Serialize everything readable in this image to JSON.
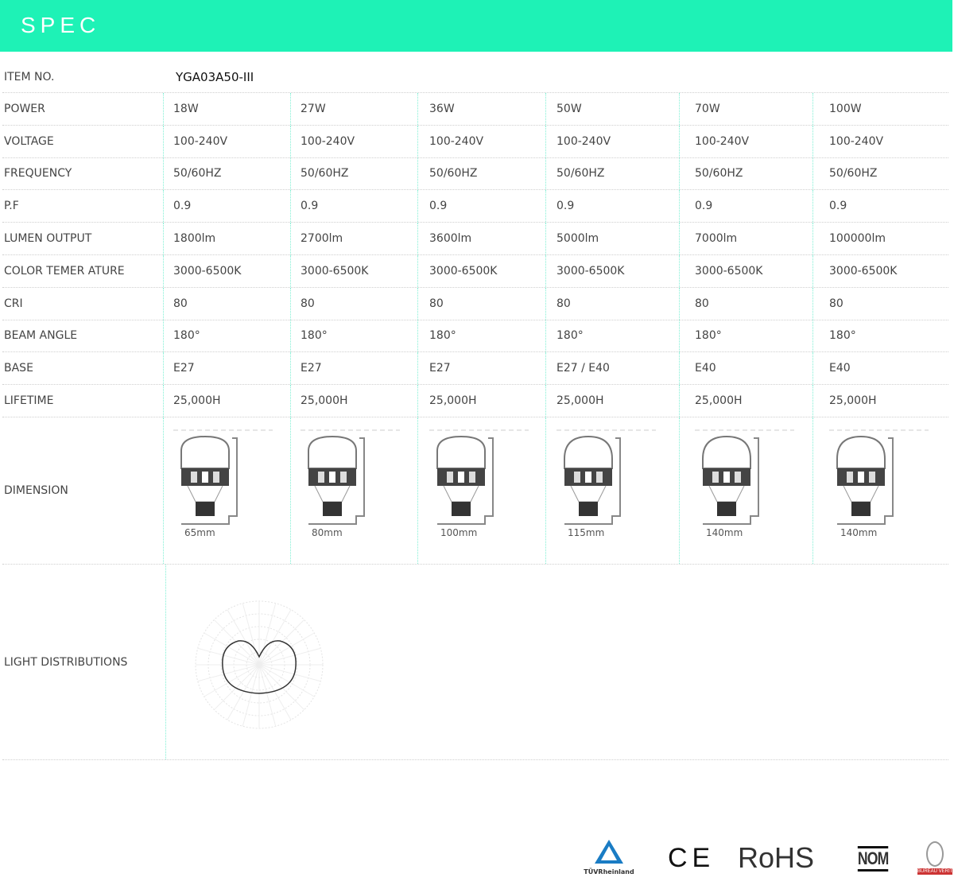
{
  "header": {
    "title": "SPEC"
  },
  "item_no": {
    "label": "ITEM NO.",
    "value": "YGA03A50-III"
  },
  "rows": [
    {
      "label": "POWER",
      "values": [
        "18W",
        "27W",
        "36W",
        "50W",
        "70W",
        "100W"
      ]
    },
    {
      "label": "VOLTAGE",
      "values": [
        "100-240V",
        "100-240V",
        "100-240V",
        "100-240V",
        "100-240V",
        "100-240V"
      ]
    },
    {
      "label": "FREQUENCY",
      "values": [
        "50/60HZ",
        "50/60HZ",
        "50/60HZ",
        "50/60HZ",
        "50/60HZ",
        "50/60HZ"
      ]
    },
    {
      "label": "P.F",
      "values": [
        "0.9",
        "0.9",
        "0.9",
        "0.9",
        "0.9",
        "0.9"
      ]
    },
    {
      "label": "LUMEN OUTPUT",
      "values": [
        "1800lm",
        "2700lm",
        "3600lm",
        "5000lm",
        "7000lm",
        "100000lm"
      ]
    },
    {
      "label": "COLOR TEMER ATURE",
      "values": [
        "3000-6500K",
        "3000-6500K",
        "3000-6500K",
        "3000-6500K",
        "3000-6500K",
        "3000-6500K"
      ]
    },
    {
      "label": "CRI",
      "values": [
        "80",
        "80",
        "80",
        "80",
        "80",
        "80"
      ]
    },
    {
      "label": "BEAM ANGLE",
      "values": [
        "180°",
        "180°",
        "180°",
        "180°",
        "180°",
        "180°"
      ]
    },
    {
      "label": "BASE",
      "values": [
        "E27",
        "E27",
        "E27",
        "E27 / E40",
        "E40",
        "E40"
      ]
    },
    {
      "label": "LIFETIME",
      "values": [
        "25,000H",
        "25,000H",
        "25,000H",
        "25,000H",
        "25,000H",
        "25,000H"
      ]
    }
  ],
  "dimension": {
    "label": "DIMENSION",
    "widths": [
      "65mm",
      "80mm",
      "100mm",
      "115mm",
      "140mm",
      "140mm"
    ]
  },
  "light_distribution": {
    "label": "LIGHT DISTRIBUTIONS"
  },
  "certifications": [
    "TÜVRheinland",
    "CE",
    "RoHS",
    "NOM",
    "BUREAU VERITAS"
  ],
  "colors": {
    "header": "#1ef2b6",
    "divider": "#7ff0d4"
  }
}
